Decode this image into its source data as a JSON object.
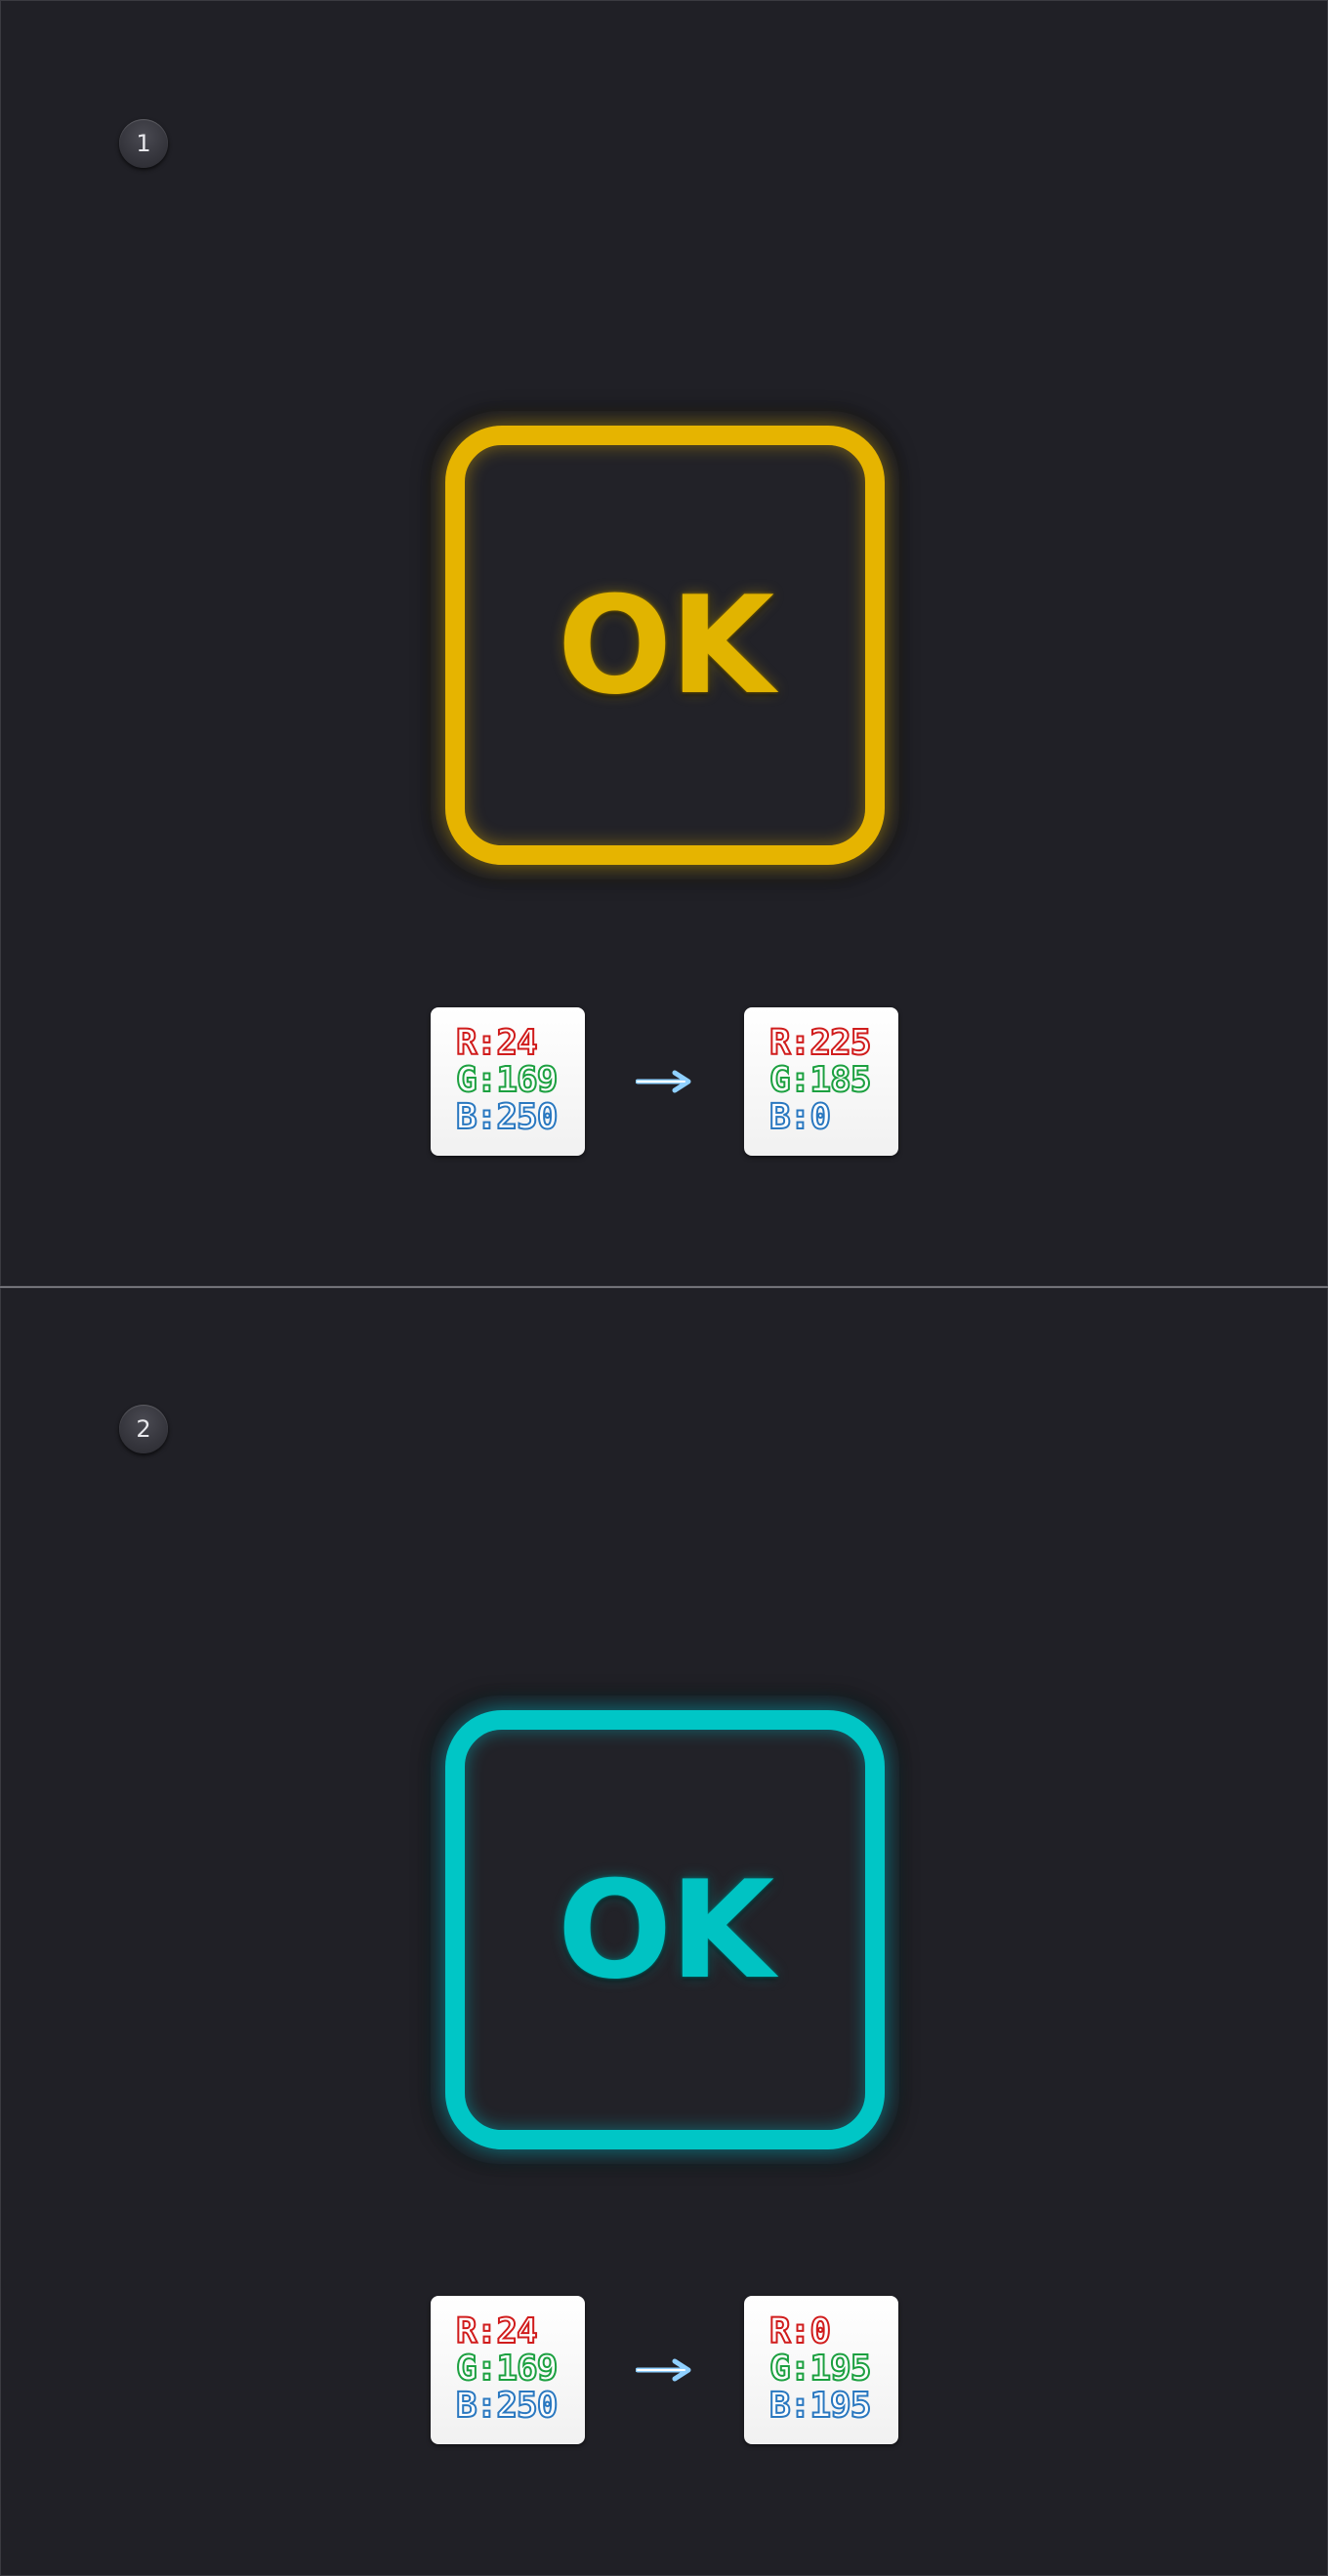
{
  "colors": {
    "background": "#202026",
    "yellow": "#e8b300",
    "cyan": "#00c3c3",
    "red_channel": "#d01c1c",
    "green_channel": "#1ca040",
    "blue_channel": "#2a78c0",
    "arrow": "#8fd0ff"
  },
  "steps": [
    {
      "number": "1",
      "icon": {
        "text": "OK",
        "color": "#e1b900"
      },
      "swatch_from": {
        "r": "R:24",
        "g": "G:169",
        "b": "B:250"
      },
      "arrow_icon": "arrow-right-icon",
      "swatch_to": {
        "r": "R:225",
        "g": "G:185",
        "b": "B:0"
      }
    },
    {
      "number": "2",
      "icon": {
        "text": "OK",
        "color": "#00c3c3"
      },
      "swatch_from": {
        "r": "R:24",
        "g": "G:169",
        "b": "B:250"
      },
      "arrow_icon": "arrow-right-icon",
      "swatch_to": {
        "r": "R:0",
        "g": "G:195",
        "b": "B:195"
      }
    }
  ]
}
